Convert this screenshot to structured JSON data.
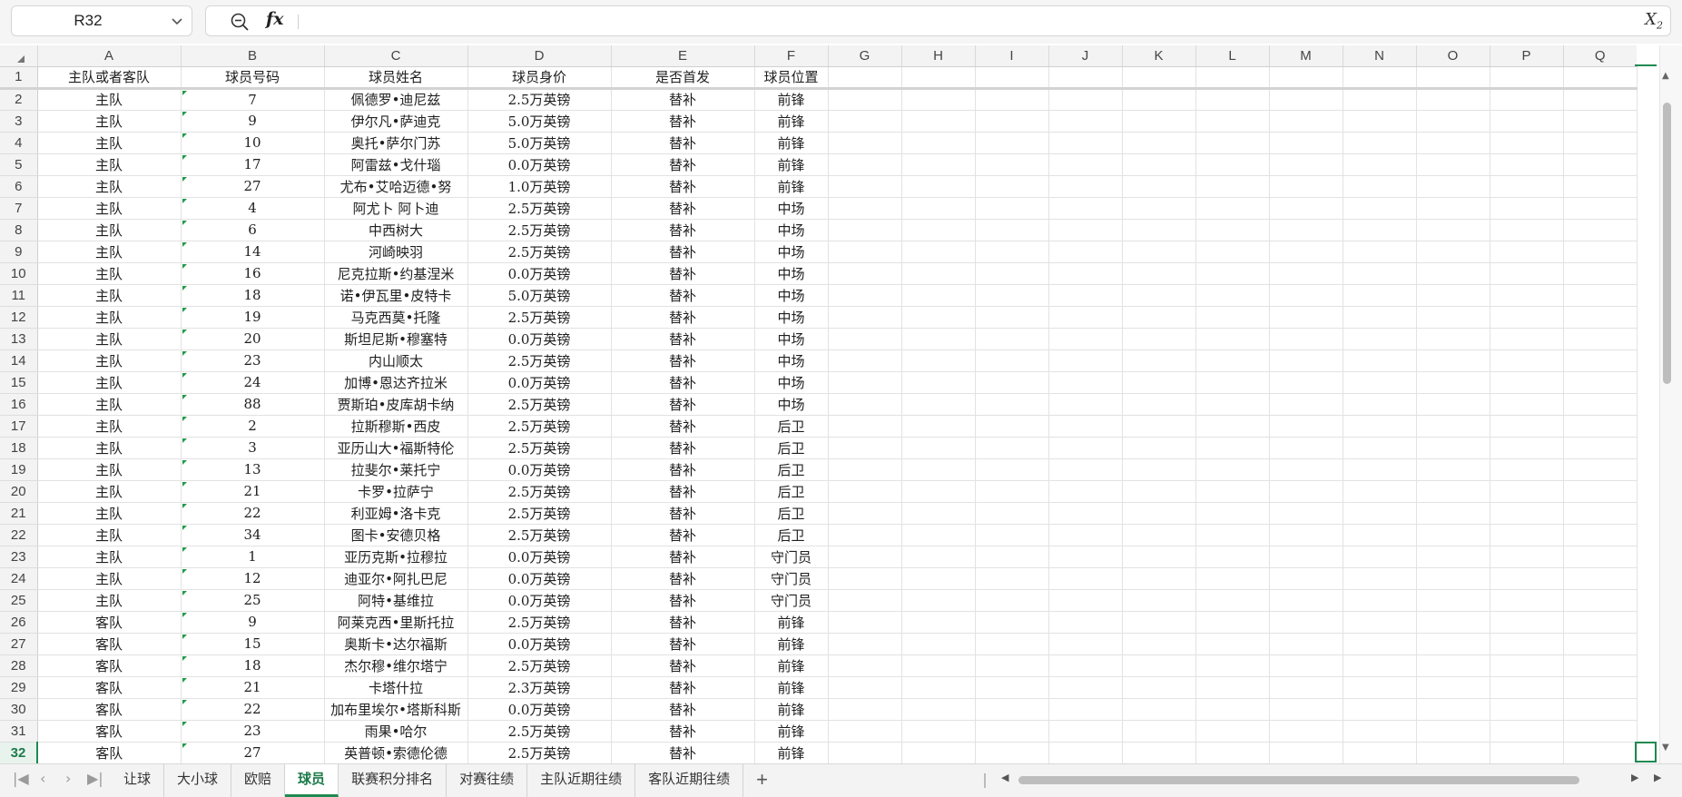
{
  "formula_bar": {
    "name_box": "R32",
    "fx_label": "fx",
    "formula": ""
  },
  "columns": [
    "A",
    "B",
    "C",
    "D",
    "E",
    "F",
    "G",
    "H",
    "I",
    "J",
    "K",
    "L",
    "M",
    "N",
    "O",
    "P",
    "Q"
  ],
  "header_row": [
    "主队或者客队",
    "球员号码",
    "球员姓名",
    "球员身价",
    "是否首发",
    "球员位置"
  ],
  "rows": [
    [
      "主队",
      "7",
      "佩德罗•迪尼兹",
      "2.5万英镑",
      "替补",
      "前锋"
    ],
    [
      "主队",
      "9",
      "伊尔凡•萨迪克",
      "5.0万英镑",
      "替补",
      "前锋"
    ],
    [
      "主队",
      "10",
      "奥托•萨尔门苏",
      "5.0万英镑",
      "替补",
      "前锋"
    ],
    [
      "主队",
      "17",
      "阿雷兹•戈什瑙",
      "0.0万英镑",
      "替补",
      "前锋"
    ],
    [
      "主队",
      "27",
      "尤布•艾哈迈德•努",
      "1.0万英镑",
      "替补",
      "前锋"
    ],
    [
      "主队",
      "4",
      "阿尤卜 阿卜迪",
      "2.5万英镑",
      "替补",
      "中场"
    ],
    [
      "主队",
      "6",
      "中西树大",
      "2.5万英镑",
      "替补",
      "中场"
    ],
    [
      "主队",
      "14",
      "河崎映羽",
      "2.5万英镑",
      "替补",
      "中场"
    ],
    [
      "主队",
      "16",
      "尼克拉斯•约基涅米",
      "0.0万英镑",
      "替补",
      "中场"
    ],
    [
      "主队",
      "18",
      "诺•伊瓦里•皮特卡",
      "5.0万英镑",
      "替补",
      "中场"
    ],
    [
      "主队",
      "19",
      "马克西莫•托隆",
      "2.5万英镑",
      "替补",
      "中场"
    ],
    [
      "主队",
      "20",
      "斯坦尼斯•穆塞特",
      "0.0万英镑",
      "替补",
      "中场"
    ],
    [
      "主队",
      "23",
      "内山顺太",
      "2.5万英镑",
      "替补",
      "中场"
    ],
    [
      "主队",
      "24",
      "加博•恩达齐拉米",
      "0.0万英镑",
      "替补",
      "中场"
    ],
    [
      "主队",
      "88",
      "贾斯珀•皮库胡卡纳",
      "2.5万英镑",
      "替补",
      "中场"
    ],
    [
      "主队",
      "2",
      "拉斯穆斯•西皮",
      "2.5万英镑",
      "替补",
      "后卫"
    ],
    [
      "主队",
      "3",
      "亚历山大•福斯特伦",
      "2.5万英镑",
      "替补",
      "后卫"
    ],
    [
      "主队",
      "13",
      "拉斐尔•莱托宁",
      "0.0万英镑",
      "替补",
      "后卫"
    ],
    [
      "主队",
      "21",
      "卡罗•拉萨宁",
      "2.5万英镑",
      "替补",
      "后卫"
    ],
    [
      "主队",
      "22",
      "利亚姆•洛卡克",
      "2.5万英镑",
      "替补",
      "后卫"
    ],
    [
      "主队",
      "34",
      "图卡•安德贝格",
      "2.5万英镑",
      "替补",
      "后卫"
    ],
    [
      "主队",
      "1",
      "亚历克斯•拉穆拉",
      "0.0万英镑",
      "替补",
      "守门员"
    ],
    [
      "主队",
      "12",
      "迪亚尔•阿扎巴尼",
      "0.0万英镑",
      "替补",
      "守门员"
    ],
    [
      "主队",
      "25",
      "阿特•基维拉",
      "0.0万英镑",
      "替补",
      "守门员"
    ],
    [
      "客队",
      "9",
      "阿莱克西•里斯托拉",
      "2.5万英镑",
      "替补",
      "前锋"
    ],
    [
      "客队",
      "15",
      "奥斯卡•达尔福斯",
      "0.0万英镑",
      "替补",
      "前锋"
    ],
    [
      "客队",
      "18",
      "杰尔穆•维尔塔宁",
      "2.5万英镑",
      "替补",
      "前锋"
    ],
    [
      "客队",
      "21",
      "卡塔什拉",
      "2.3万英镑",
      "替补",
      "前锋"
    ],
    [
      "客队",
      "22",
      "加布里埃尔•塔斯科斯",
      "0.0万英镑",
      "替补",
      "前锋"
    ],
    [
      "客队",
      "23",
      "雨果•哈尔",
      "2.5万英镑",
      "替补",
      "前锋"
    ],
    [
      "客队",
      "27",
      "英普顿•索德伦德",
      "2.5万英镑",
      "替补",
      "前锋"
    ]
  ],
  "active_row": 32,
  "sheet_tabs": [
    "让球",
    "大小球",
    "欧赔",
    "球员",
    "联赛积分排名",
    "对赛往绩",
    "主队近期往绩",
    "客队近期往绩"
  ],
  "active_tab": "球员",
  "accent_color": "#1f8a50"
}
